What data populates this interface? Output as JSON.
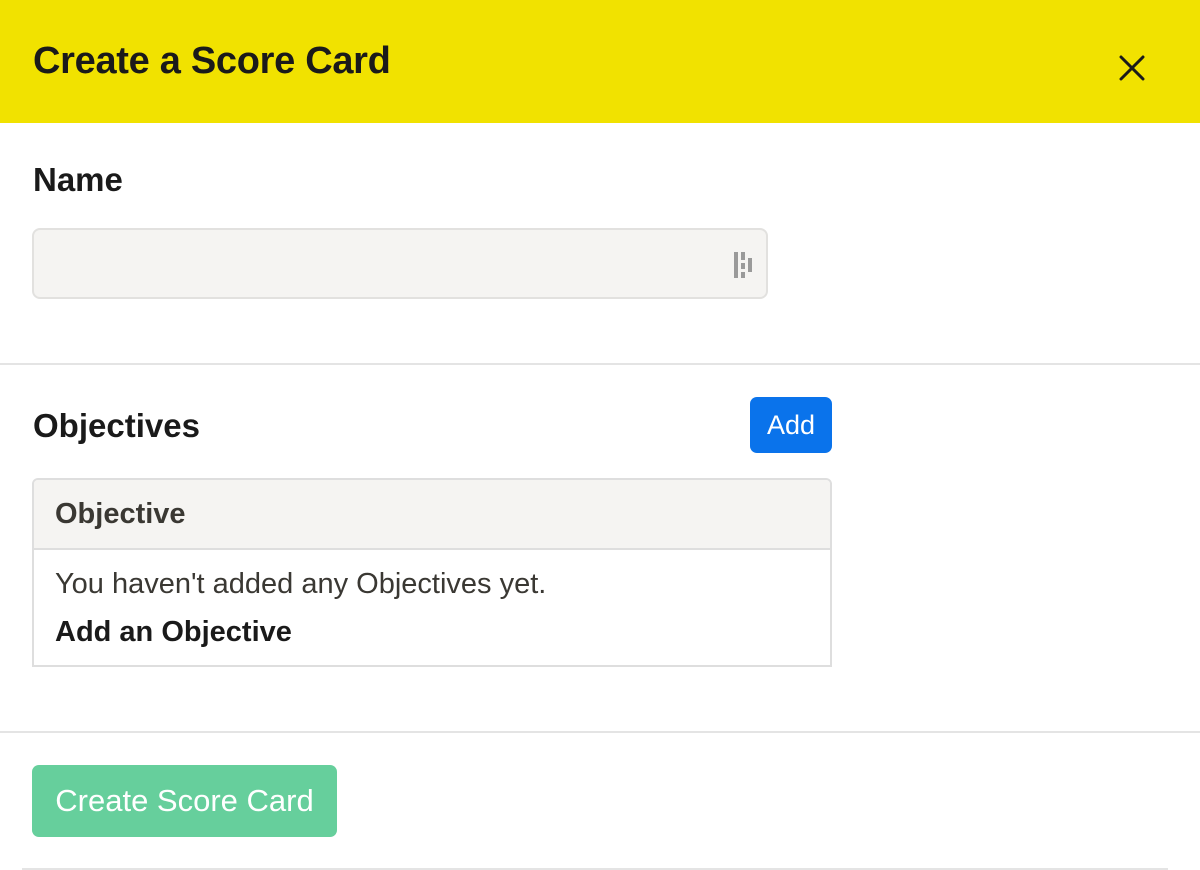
{
  "header": {
    "title": "Create a Score Card"
  },
  "name_section": {
    "label": "Name",
    "input_value": "",
    "input_placeholder": ""
  },
  "objectives_section": {
    "label": "Objectives",
    "add_label": "Add",
    "table": {
      "column_header": "Objective",
      "empty_message": "You haven't added any Objectives yet.",
      "empty_action": "Add an Objective"
    }
  },
  "footer": {
    "create_label": "Create Score Card"
  },
  "colors": {
    "header_bg": "#f1e200",
    "add_button": "#0a73eb",
    "create_button": "#66cf9c"
  },
  "icons": {
    "close": "close-icon",
    "password_manager": "password-manager-icon"
  }
}
